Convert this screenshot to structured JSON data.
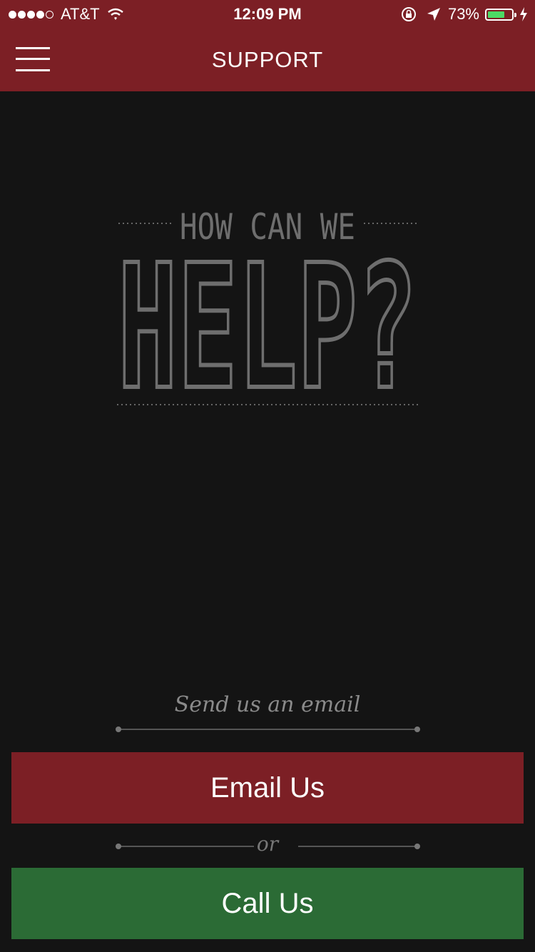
{
  "status_bar": {
    "carrier": "AT&T",
    "time": "12:09 PM",
    "battery_percent": "73%",
    "battery_level": 0.73,
    "signal_bars": 4,
    "signal_max": 5
  },
  "nav": {
    "title": "SUPPORT",
    "menu_icon": "hamburger-icon"
  },
  "hero": {
    "line1": "HOW CAN WE",
    "line2": "HELP?"
  },
  "contact": {
    "email_prompt": "Send us an email",
    "email_button": "Email Us",
    "separator": "or",
    "call_button": "Call Us"
  },
  "colors": {
    "header": "#7c1f25",
    "email_button": "#7c1f25",
    "call_button": "#2b6b35",
    "background": "#141414",
    "hero_text": "#6e6e6e"
  }
}
